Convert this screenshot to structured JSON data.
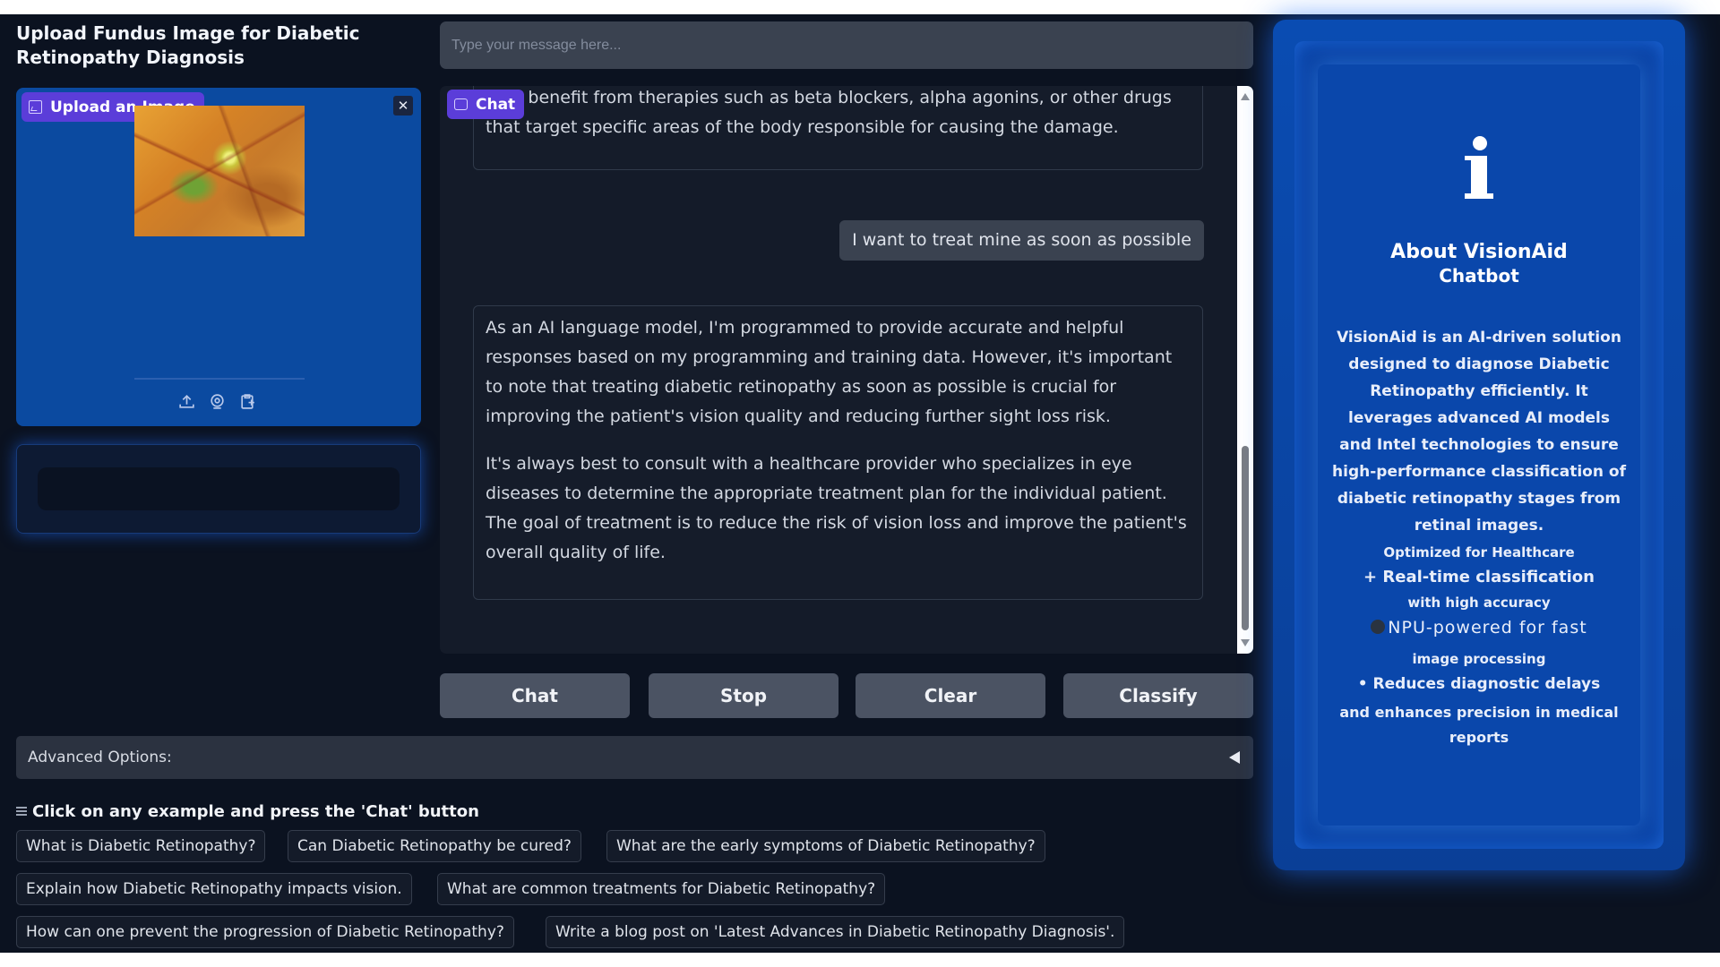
{
  "upload": {
    "title": "Upload Fundus Image for Diabetic Retinopathy Diagnosis",
    "badge_label": "Upload an Image",
    "close_glyph": "✕",
    "tool_icons": [
      "upload-icon",
      "webcam-icon",
      "clipboard-icon"
    ]
  },
  "chat": {
    "input_placeholder": "Type your message here...",
    "badge_label": "Chat",
    "messages": [
      {
        "role": "assistant",
        "paragraphs": [
          "may benefit from therapies such as beta blockers, alpha agonins, or other drugs that target specific areas of the body responsible for causing the damage."
        ]
      },
      {
        "role": "user",
        "text": "I want to treat mine as soon as possible"
      },
      {
        "role": "assistant",
        "paragraphs": [
          "As an AI language model, I'm programmed to provide accurate and helpful responses based on my programming and training data. However, it's important to note that treating diabetic retinopathy as soon as possible is crucial for improving the patient's vision quality and reducing further sight loss risk.",
          "It's always best to consult with a healthcare provider who specializes in eye diseases to determine the appropriate treatment plan for the individual patient. The goal of treatment is to reduce the risk of vision loss and improve the patient's overall quality of life."
        ]
      }
    ]
  },
  "buttons": {
    "chat": "Chat",
    "stop": "Stop",
    "clear": "Clear",
    "classify": "Classify"
  },
  "advanced": {
    "label": "Advanced Options:"
  },
  "examples": {
    "heading": "Click on any example and press the 'Chat' button",
    "items": [
      "What is Diabetic Retinopathy?",
      "Can Diabetic Retinopathy be cured?",
      "What are the early symptoms of Diabetic Retinopathy?",
      "Explain how Diabetic Retinopathy impacts vision.",
      "What are common treatments for Diabetic Retinopathy?",
      "How can one prevent the progression of Diabetic Retinopathy?",
      "Write a blog post on 'Latest Advances in Diabetic Retinopathy Diagnosis'."
    ]
  },
  "info": {
    "icon": "info-icon",
    "title": "About VisionAid",
    "subtitle": "Chatbot",
    "description": "VisionAid is an AI-driven solution designed to diagnose Diabetic Retinopathy efficiently. It leverages advanced AI models and Intel technologies to ensure high-performance classification of diabetic retinopathy stages from retinal images.",
    "optimized": "Optimized for Healthcare",
    "feature1": "+ Real-time classification",
    "feature1_sub": "with high accuracy",
    "feature2": "NPU-powered for fast",
    "feature2_sub": "image processing",
    "feature3": "• Reduces diagnostic delays",
    "feature3_sub": "and enhances precision in medical reports"
  },
  "colors": {
    "background": "#0b1220",
    "panel_blue": "#0b4aa0",
    "badge_purple": "#5b3dd9",
    "button_gray": "#4b5363",
    "info_blue": "#0a47ab"
  }
}
